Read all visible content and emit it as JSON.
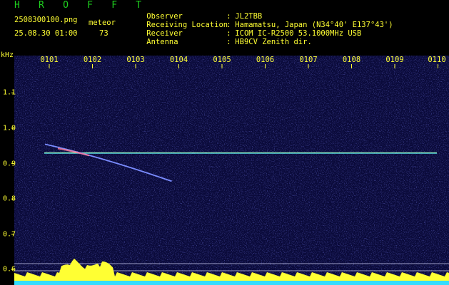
{
  "header": {
    "app_title": "H R O F F T",
    "filename": "2508300100.png",
    "datetime": "25.08.30 01:00",
    "meteor_label": "meteor",
    "meteor_count": "73"
  },
  "station_info": [
    {
      "key": "Observer",
      "value": "JL2TBB"
    },
    {
      "key": "Receiving Location",
      "value": "Hamamatsu, Japan (N34°40' E137°43')"
    },
    {
      "key": "Receiver",
      "value": "ICOM IC-R2500 53.1000MHz USB"
    },
    {
      "key": "Antenna",
      "value": "HB9CV Zenith dir."
    }
  ],
  "axes": {
    "y_unit": "kHz",
    "x_ticks": [
      "0101",
      "0102",
      "0103",
      "0104",
      "0105",
      "0106",
      "0107",
      "0108",
      "0109",
      "0110"
    ],
    "y_ticks": [
      "1.1",
      "1.0",
      "0.9",
      "0.8",
      "0.7",
      "0.6"
    ]
  },
  "signals": {
    "carrier_freq_khz": 0.93,
    "meteor_echo_start": {
      "minute": 0,
      "khz": 0.955
    },
    "meteor_echo_end": {
      "minute": 3.0,
      "khz": 0.85
    }
  },
  "colors": {
    "background": "#000000",
    "waterfall": "#0a0a3a",
    "label": "#ffff33",
    "title": "#1fd21f",
    "carrier": "#33ccee",
    "histogram": "#ffff33",
    "baseline": "#33ddff"
  }
}
